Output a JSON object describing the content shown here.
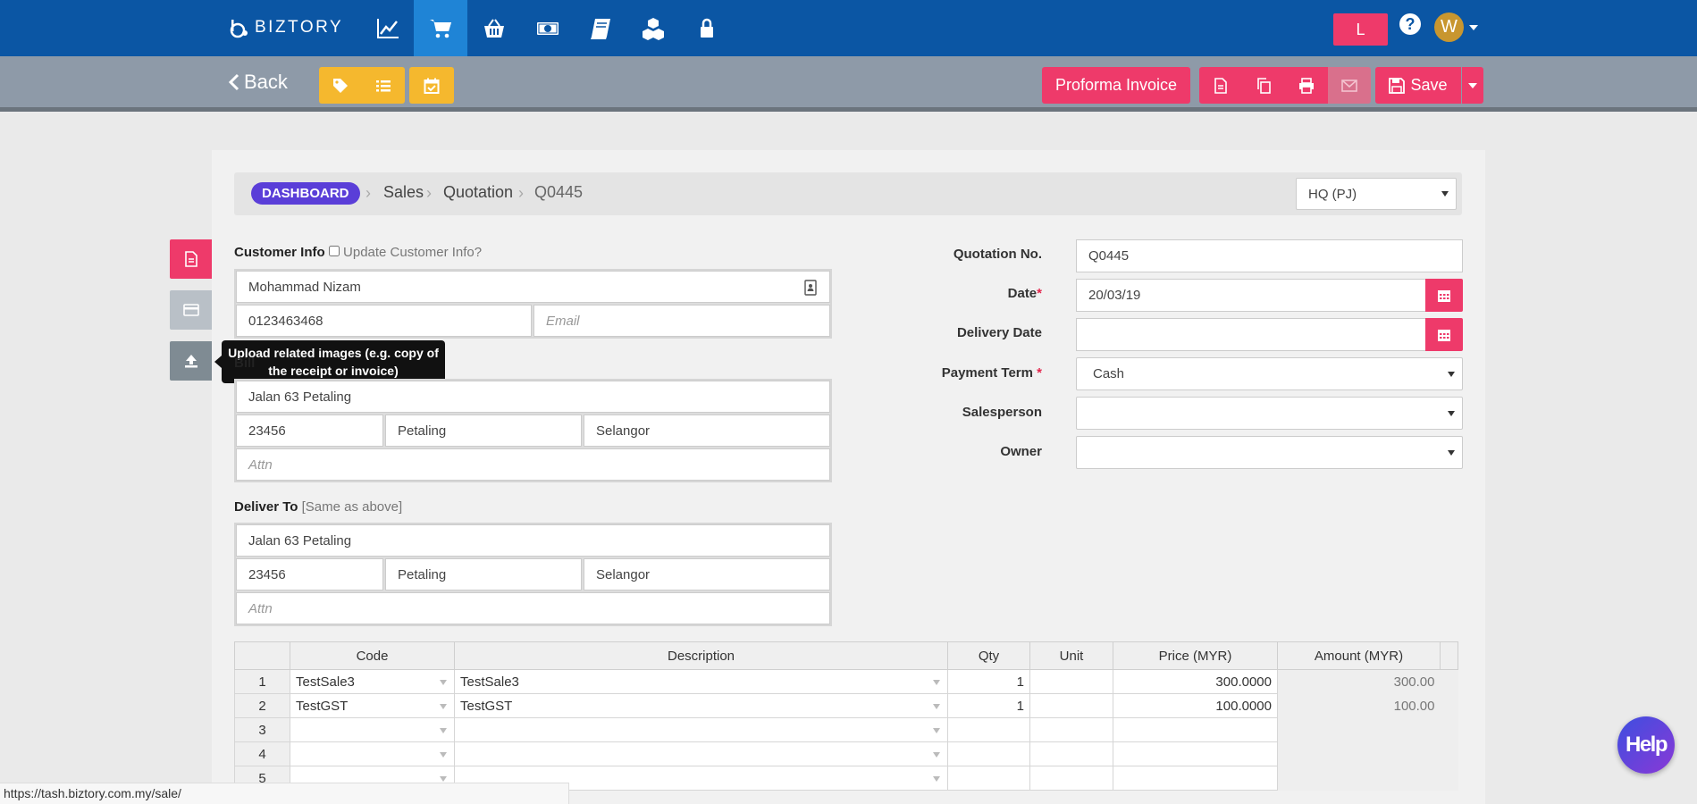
{
  "nav": {
    "brand": "BIZTORY",
    "icons": [
      "chart-line-icon",
      "cart-icon",
      "basket-icon",
      "money-icon",
      "book-icon",
      "boxes-icon",
      "lock-icon"
    ],
    "l_button": "L",
    "help": "?",
    "avatar_initial": "W",
    "colors": {
      "nav_bg": "#0b56a4",
      "active_tab": "#1f84d6",
      "accent_pink": "#ee3a6a",
      "accent_yellow": "#f5b82e"
    }
  },
  "toolbar": {
    "back_label": "Back",
    "proforma_label": "Proforma Invoice",
    "save_label": "Save"
  },
  "breadcrumb": {
    "dashboard": "DASHBOARD",
    "items": [
      "Sales",
      "Quotation",
      "Q0445"
    ],
    "branch": "HQ (PJ)"
  },
  "tooltip": "Upload related images (e.g. copy of the receipt or invoice)",
  "customer": {
    "label": "Customer Info",
    "update_label": "Update Customer Info?",
    "name": "Mohammad Nizam",
    "phone": "0123463468",
    "email_placeholder": "Email"
  },
  "billing": {
    "label_partial": "Bill",
    "address": "Jalan 63 Petaling",
    "postcode": "23456",
    "city": "Petaling",
    "state": "Selangor",
    "attn_placeholder": "Attn"
  },
  "delivery": {
    "label": "Deliver To",
    "same_as": "[Same as above]",
    "address": "Jalan 63 Petaling",
    "postcode": "23456",
    "city": "Petaling",
    "state": "Selangor",
    "attn_placeholder": "Attn"
  },
  "quotation": {
    "no_label": "Quotation No.",
    "no": "Q0445",
    "date_label": "Date",
    "date": "20/03/19",
    "delivery_date_label": "Delivery Date",
    "delivery_date": "",
    "payment_term_label": "Payment Term",
    "payment_term": "Cash",
    "salesperson_label": "Salesperson",
    "salesperson": "",
    "owner_label": "Owner",
    "owner": "",
    "required_mark": "*"
  },
  "items_table": {
    "headers": [
      "Code",
      "Description",
      "Qty",
      "Unit",
      "Price (MYR)",
      "Amount (MYR)"
    ],
    "rows": [
      {
        "num": "1",
        "code": "TestSale3",
        "description": "TestSale3",
        "qty": "1",
        "unit": "",
        "price": "300.0000",
        "amount": "300.00"
      },
      {
        "num": "2",
        "code": "TestGST",
        "description": "TestGST",
        "qty": "1",
        "unit": "",
        "price": "100.0000",
        "amount": "100.00"
      },
      {
        "num": "3",
        "code": "",
        "description": "",
        "qty": "",
        "unit": "",
        "price": "",
        "amount": ""
      },
      {
        "num": "4",
        "code": "",
        "description": "",
        "qty": "",
        "unit": "",
        "price": "",
        "amount": ""
      },
      {
        "num": "5",
        "code": "",
        "description": "",
        "qty": "",
        "unit": "",
        "price": "",
        "amount": ""
      }
    ]
  },
  "status_url": "https://tash.biztory.com.my/sale/",
  "help_bubble": "Help"
}
